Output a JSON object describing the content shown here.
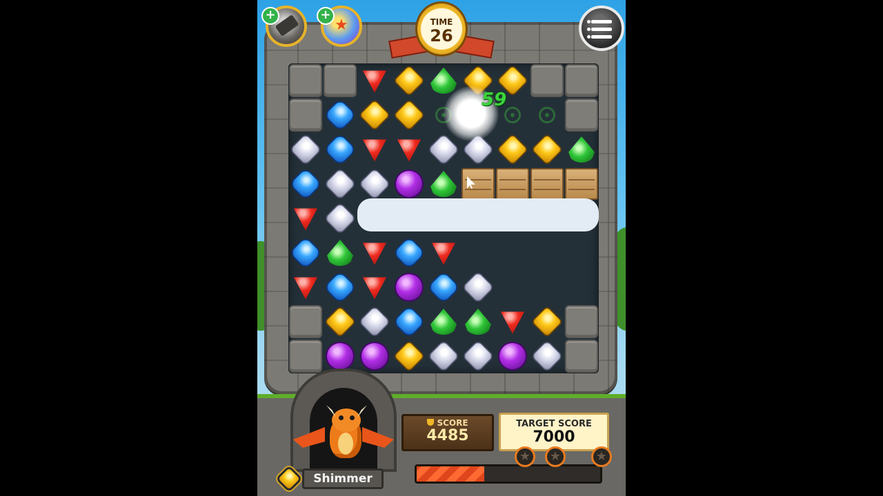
{
  "hud": {
    "timer_label": "TIME",
    "timer_value": "26",
    "score_label": "SCORE",
    "score_value": "4485",
    "target_label": "TARGET SCORE",
    "target_value": "7000",
    "floating_points": "59",
    "character_name": "Shimmer",
    "progress_fraction": 0.37
  },
  "board": {
    "cols": 9,
    "rows": 9,
    "cells": [
      [
        "stone",
        "stone",
        "red",
        "yellow",
        "green",
        "yellow",
        "yellow",
        "stone",
        "stone"
      ],
      [
        "stone",
        "blue",
        "yellow",
        "yellow",
        "swirl",
        "flash",
        "swirl",
        "swirl",
        "stone"
      ],
      [
        "white",
        "blue",
        "red",
        "red",
        "white",
        "white",
        "yellow",
        "yellow",
        "green"
      ],
      [
        "blue",
        "white",
        "white",
        "purple",
        "green",
        "crate",
        "crate",
        "crate",
        "crate"
      ],
      [
        "red",
        "white",
        "cloud",
        "cloud",
        "cloud",
        "cloud",
        "cloud",
        "cloud",
        "cloud"
      ],
      [
        "blue",
        "green",
        "red",
        "blue",
        "red",
        "empty",
        "empty",
        "empty",
        "empty"
      ],
      [
        "red",
        "blue",
        "red",
        "purple",
        "blue",
        "white",
        "empty",
        "empty",
        "empty"
      ],
      [
        "stone",
        "yellow",
        "white",
        "blue",
        "green",
        "green",
        "red",
        "yellow",
        "stone"
      ],
      [
        "stone",
        "purple",
        "purple",
        "yellow",
        "white",
        "white",
        "purple",
        "white",
        "stone"
      ]
    ]
  },
  "colors": {
    "sky": "#2ea2e6",
    "stone": "#7c7a74",
    "board": "#243038",
    "progress": "#e0451c",
    "points": "#3cd43c"
  },
  "icons": {
    "powerup_1": "hammer-icon",
    "powerup_2": "star-ball-icon",
    "menu": "menu-icon",
    "star": "star-icon"
  }
}
